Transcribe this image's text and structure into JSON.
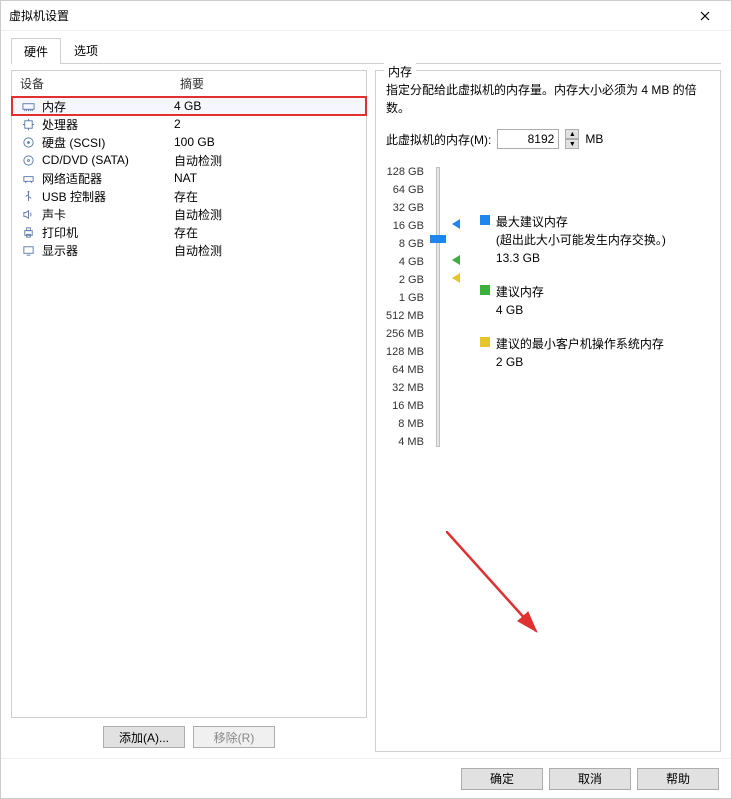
{
  "title": "虚拟机设置",
  "tabs": {
    "hardware": "硬件",
    "options": "选项"
  },
  "columns": {
    "device": "设备",
    "summary": "摘要"
  },
  "devices": [
    {
      "name": "内存",
      "summary": "4 GB",
      "icon": "memory"
    },
    {
      "name": "处理器",
      "summary": "2",
      "icon": "cpu"
    },
    {
      "name": "硬盘 (SCSI)",
      "summary": "100 GB",
      "icon": "disk"
    },
    {
      "name": "CD/DVD (SATA)",
      "summary": "自动检测",
      "icon": "cd"
    },
    {
      "name": "网络适配器",
      "summary": "NAT",
      "icon": "net"
    },
    {
      "name": "USB 控制器",
      "summary": "存在",
      "icon": "usb"
    },
    {
      "name": "声卡",
      "summary": "自动检测",
      "icon": "sound"
    },
    {
      "name": "打印机",
      "summary": "存在",
      "icon": "printer"
    },
    {
      "name": "显示器",
      "summary": "自动检测",
      "icon": "display"
    }
  ],
  "buttons": {
    "add": "添加(A)...",
    "remove": "移除(R)",
    "ok": "确定",
    "cancel": "取消",
    "help": "帮助"
  },
  "memory": {
    "groupTitle": "内存",
    "desc": "指定分配给此虚拟机的内存量。内存大小必须为 4 MB 的倍数。",
    "label": "此虚拟机的内存(M):",
    "value": "8192",
    "unit": "MB",
    "ticks": [
      "128 GB",
      "64 GB",
      "32 GB",
      "16 GB",
      "8 GB",
      "4 GB",
      "2 GB",
      "1 GB",
      "512 MB",
      "256 MB",
      "128 MB",
      "64 MB",
      "32 MB",
      "16 MB",
      "8 MB",
      "4 MB"
    ],
    "legend": {
      "max": {
        "title": "最大建议内存",
        "sub": "(超出此大小可能发生内存交换。)",
        "value": "13.3 GB"
      },
      "rec": {
        "title": "建议内存",
        "value": "4 GB"
      },
      "min": {
        "title": "建议的最小客户机操作系统内存",
        "value": "2 GB"
      }
    }
  }
}
